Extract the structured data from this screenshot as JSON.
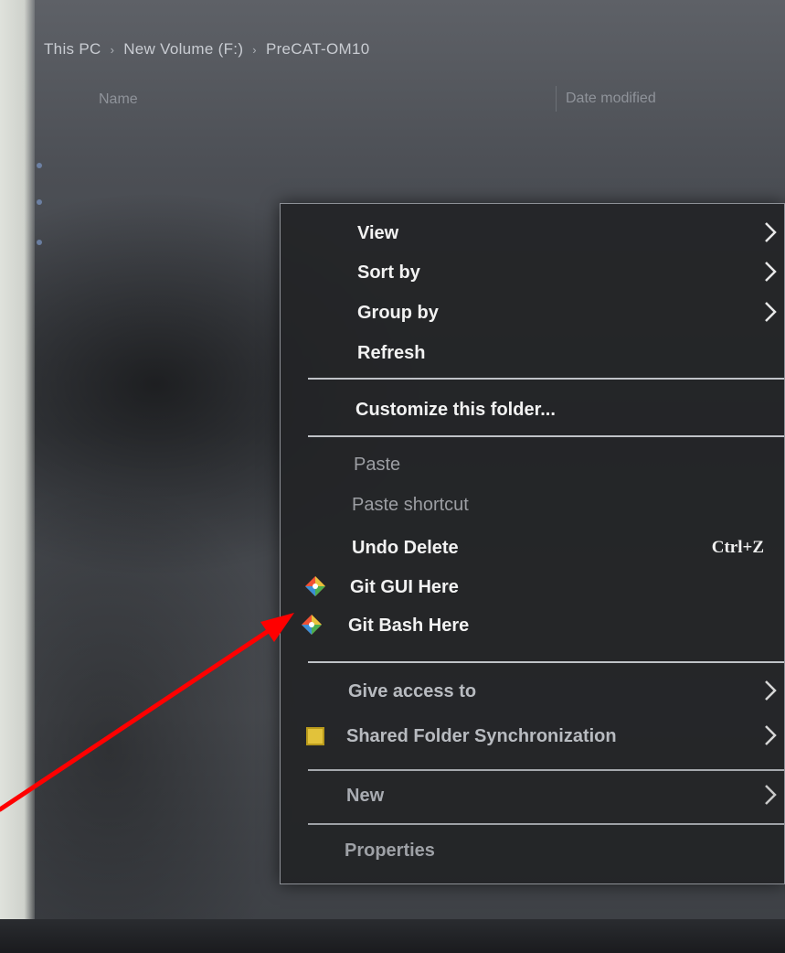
{
  "breadcrumb": {
    "items": [
      "This PC",
      "New Volume (F:)",
      "PreCAT-OM10"
    ]
  },
  "columns": {
    "name": "Name",
    "date_modified": "Date modified"
  },
  "context_menu": {
    "view": "View",
    "sort_by": "Sort by",
    "group_by": "Group by",
    "refresh": "Refresh",
    "customize": "Customize this folder...",
    "paste": "Paste",
    "paste_shortcut": "Paste shortcut",
    "undo_delete": "Undo Delete",
    "undo_delete_shortcut": "Ctrl+Z",
    "git_gui": "Git GUI Here",
    "git_bash": "Git Bash Here",
    "give_access": "Give access to",
    "shared_sync": "Shared Folder Synchronization",
    "new": "New",
    "properties": "Properties"
  },
  "icons": {
    "git": "git-icon",
    "sync": "shared-folder-sync-icon",
    "chevron": "chevron-right-icon"
  },
  "colors": {
    "annotation_arrow": "#ff0000",
    "menu_background": "#222326",
    "git_orange": "#f05133"
  }
}
